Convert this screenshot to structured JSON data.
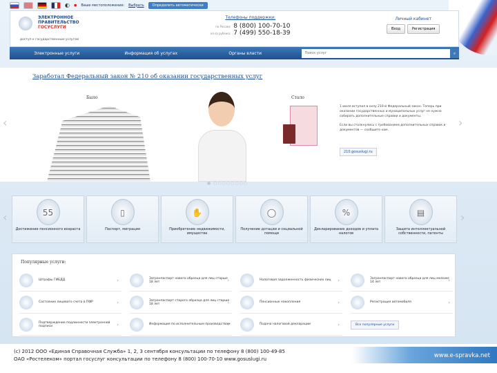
{
  "topbar": {
    "flags": [
      "ru",
      "uk",
      "de",
      "fr"
    ],
    "location_label": "Ваше местоположение:",
    "location_value": "Выбрать",
    "location_button": "Определить автоматически"
  },
  "header": {
    "logo_line1": "ЭЛЕКТРОННОЕ",
    "logo_line2": "ПРАВИТЕЛЬСТВО",
    "logo_line3": "ГОСУСЛУГИ",
    "tagline": "доступ к государственным услугам",
    "phones_title": "Телефоны поддержки:",
    "phone1_label": "по России:",
    "phone1": "8 (800) 100-70-10",
    "phone2_label": "из-за рубежа:",
    "phone2": "7 (499) 550-18-39",
    "cabinet_title": "Личный кабинет",
    "login": "Вход",
    "register": "Регистрация"
  },
  "nav": {
    "items": [
      "Электронные услуги",
      "Информация об услугах",
      "Органы власти"
    ],
    "search_placeholder": "Поиск услуг",
    "search_icon": "search-icon"
  },
  "banner": {
    "title": "Заработал Федеральный закон № 210 об оказании государственных услуг",
    "was": "Было",
    "now": "Стало",
    "text1": "1 июля вступил в силу 210-й Федеральный закон. Теперь при оказании государственных и муниципальных услуг не нужно собирать дополнительные справки и документы.",
    "text2": "Если вы столкнулись с требованием дополнительных справок и документов — сообщите нам.",
    "link": "210.gosuslugi.ru",
    "dots": "● ○○○○○○○○"
  },
  "categories": [
    "Достижение пенсионного возраста",
    "Паспорт, миграция",
    "Приобретение недвижимости, имущества",
    "Получение дотации и социальной помощи",
    "Декларирование доходов и уплата налогов",
    "Защита интеллектуальной собственности, патенты"
  ],
  "category_icons": [
    "55",
    "▯",
    "✋",
    "◯",
    "%",
    "▤"
  ],
  "popular": {
    "title": "Популярные услуги:",
    "items": [
      "Штрафы ГИБДД",
      "Загранпаспорт нового образца для лиц старше 18 лет",
      "Налоговая задолженность физических лиц",
      "Загранпаспорт нового образца для лиц моложе 14 лет",
      "Состояние лицевого счета в ПФР",
      "Загранпаспорт старого образца для лиц старше 18 лет",
      "Пенсионные накопления",
      "Регистрация автомобиля",
      "Подтверждение подлинности электронной подписи",
      "Информация по исполнительным производствам",
      "Подача налоговой декларации"
    ],
    "all_button": "Все популярные услуги"
  },
  "footer": {
    "line1": "(с) 2012 ООО «Единая Справочная Служба» 1, 2, 3 сентября консультации по телефону 8 (800) 100-49-85",
    "line2": "ОАО «Ростелеком» портал госуслуг консультации по телефону 8 (800) 100-70-10 www.gosuslugi.ru",
    "brand": "www.e-spravka.net"
  },
  "colors": {
    "brand_blue": "#1e4f8d",
    "accent": "#3f7fc1",
    "flag_red": "#d52020"
  }
}
